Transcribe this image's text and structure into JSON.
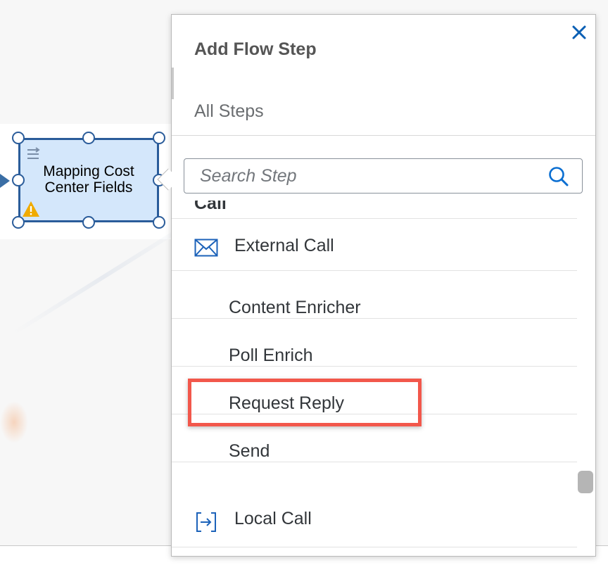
{
  "node": {
    "title_line1": "Mapping Cost",
    "title_line2": "Center Fields",
    "type_icon": "mapping-icon",
    "status_icon": "warning-icon",
    "border_color": "#2a5c9a",
    "fill_color": "#d4e7fb"
  },
  "popover": {
    "title": "Add Flow Step",
    "close_icon": "close-icon",
    "subheader": "All Steps",
    "search": {
      "placeholder": "Search Step",
      "icon": "search-icon"
    }
  },
  "list": {
    "partial_group_label": "Call",
    "groups": [
      {
        "label": "External Call",
        "icon": "envelope-icon",
        "items": [
          "Content Enricher",
          "Poll Enrich",
          "Request Reply",
          "Send"
        ]
      },
      {
        "label": "Local Call",
        "icon": "local-call-icon",
        "items": []
      }
    ],
    "highlighted_item": "Request Reply",
    "highlight_color": "#f2574b"
  },
  "colors": {
    "accent": "#0a6ed1",
    "text": "#32363a",
    "subheader_text": "#6a6d70"
  }
}
